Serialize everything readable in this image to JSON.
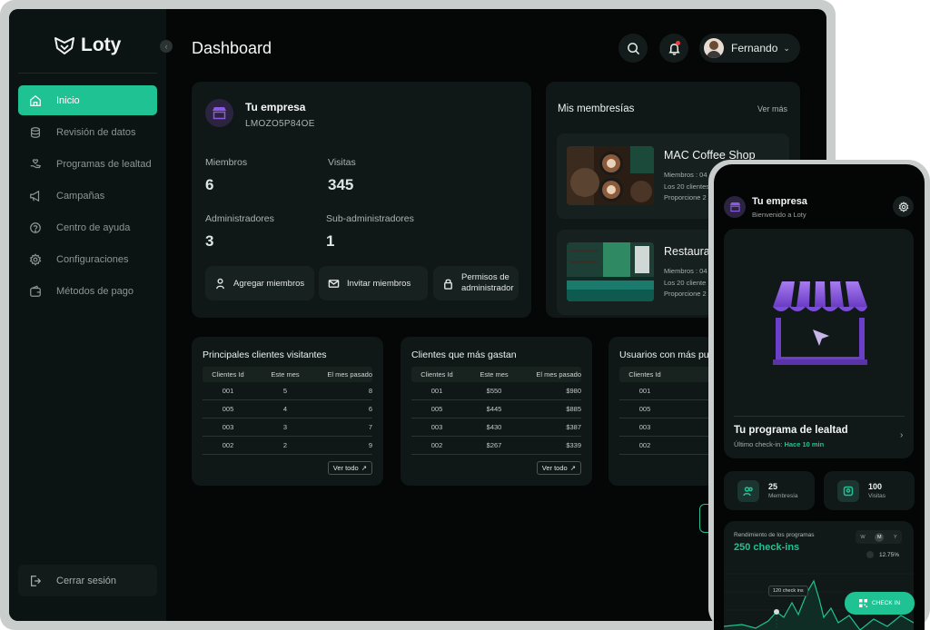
{
  "app": {
    "name": "Loty"
  },
  "sidebar": {
    "items": [
      {
        "label": "Inicio",
        "icon": "home-icon",
        "active": true
      },
      {
        "label": "Revisión de datos",
        "icon": "database-icon"
      },
      {
        "label": "Programas de lealtad",
        "icon": "loyalty-hand-icon"
      },
      {
        "label": "Campañas",
        "icon": "megaphone-icon"
      },
      {
        "label": "Centro de ayuda",
        "icon": "help-icon"
      },
      {
        "label": "Configuraciones",
        "icon": "gear-icon"
      },
      {
        "label": "Métodos de pago",
        "icon": "wallet-icon"
      }
    ],
    "logout_label": "Cerrar sesión"
  },
  "header": {
    "title": "Dashboard",
    "user_name": "Fernando"
  },
  "company": {
    "name": "Tu empresa",
    "code": "LMOZO5P84OE",
    "stats": [
      {
        "label": "Miembros",
        "value": "6"
      },
      {
        "label": "Visitas",
        "value": "345"
      },
      {
        "label": "Administradores",
        "value": "3"
      },
      {
        "label": "Sub-administradores",
        "value": "1"
      }
    ],
    "actions": {
      "add_members": "Agregar miembros",
      "invite_members": "Invitar miembros",
      "admin_perm_line1": "Permisos de",
      "admin_perm_line2": "administrador"
    }
  },
  "memberships": {
    "title": "Mis membresías",
    "more": "Ver más",
    "shops": [
      {
        "name": "MAC Coffee Shop",
        "line1": "Miembros : 04",
        "line2": "Los 20 clientes",
        "line3": "Proporcione 2"
      },
      {
        "name": "Restaura",
        "line1": "Miembros : 04",
        "line2": "Los 20 cliente",
        "line3": "Proporcione 2"
      }
    ]
  },
  "tables": [
    {
      "title": "Principales clientes visitantes",
      "headers": [
        "Clientes Id",
        "Este mes",
        "El mes pasado"
      ],
      "rows": [
        [
          "001",
          "5",
          "8"
        ],
        [
          "005",
          "4",
          "6"
        ],
        [
          "003",
          "3",
          "7"
        ],
        [
          "002",
          "2",
          "9"
        ]
      ],
      "more": "Ver todo"
    },
    {
      "title": "Clientes que más gastan",
      "headers": [
        "Clientes Id",
        "Este mes",
        "El mes pasado"
      ],
      "rows": [
        [
          "001",
          "$550",
          "$980"
        ],
        [
          "005",
          "$445",
          "$885"
        ],
        [
          "003",
          "$430",
          "$387"
        ],
        [
          "002",
          "$267",
          "$339"
        ]
      ],
      "more": "Ver todo"
    },
    {
      "title": "Usuarios con más pu",
      "headers": [
        "Clientes Id"
      ],
      "rows": [
        [
          "001"
        ],
        [
          "005"
        ],
        [
          "003"
        ],
        [
          "002"
        ]
      ]
    }
  ],
  "phone": {
    "company_name": "Tu empresa",
    "welcome": "Bienvenido a Loty",
    "loyalty_title": "Tu programa de lealtad",
    "last_checkin_label": "Último check-in:",
    "last_checkin_value": "Hace 10 min",
    "members_value": "25",
    "members_label": "Membresía",
    "visits_value": "100",
    "visits_label": "Visitas",
    "perf_title": "Rendimiento de los programas",
    "perf_value": "250 check-ins",
    "seg_w": "W",
    "seg_m": "M",
    "seg_y": "Y",
    "pct": "12.75%",
    "tooltip": "120 check ins",
    "checkin_button": "CHECK IN"
  },
  "colors": {
    "accent": "#1fc393",
    "purple": "#7b4fd1",
    "background": "#050606",
    "card": "#0f1817"
  }
}
